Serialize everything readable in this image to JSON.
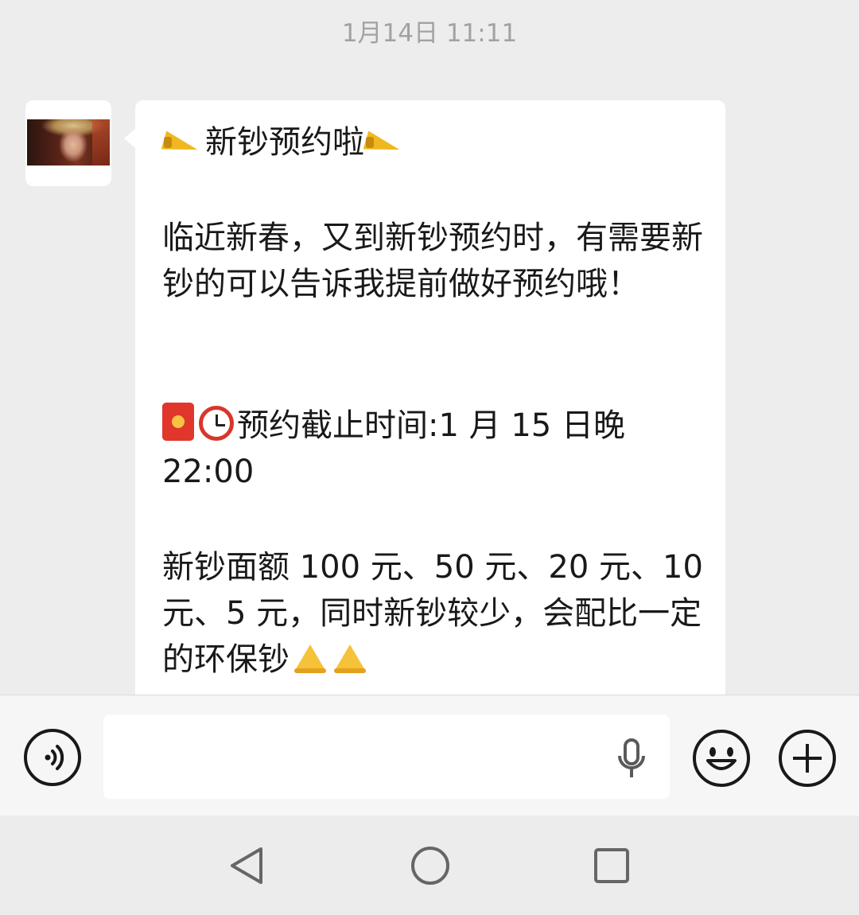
{
  "chat": {
    "timestamp": "1月14日 11:11",
    "message": {
      "title": "新钞预约啦",
      "paragraph1": "临近新春，又到新钞预约时，有需要新钞的可以告诉我提前做好预约哦！",
      "deadline": "预约截止时间:1 月 15 日晚 22:00",
      "paragraph3": "新钞面额 100 元、50 元、20 元、10 元、5 元，同时新钞较少，会配比一定的环保钞"
    },
    "icons": {
      "title_emoji": "megaphone-icon",
      "deadline_emoji": [
        "red-envelope-icon",
        "alarm-clock-icon"
      ],
      "closing_emoji": "folded-hands-icon"
    }
  },
  "input_bar": {
    "message_value": "",
    "icons": [
      "voice-icon",
      "microphone-icon",
      "emoji-icon",
      "plus-icon"
    ]
  },
  "nav": {
    "icons": [
      "back-icon",
      "home-icon",
      "recents-icon"
    ]
  },
  "colors": {
    "background": "#ededed",
    "bubble": "#ffffff",
    "text": "#191919",
    "timestamp": "#a2a2a2"
  }
}
